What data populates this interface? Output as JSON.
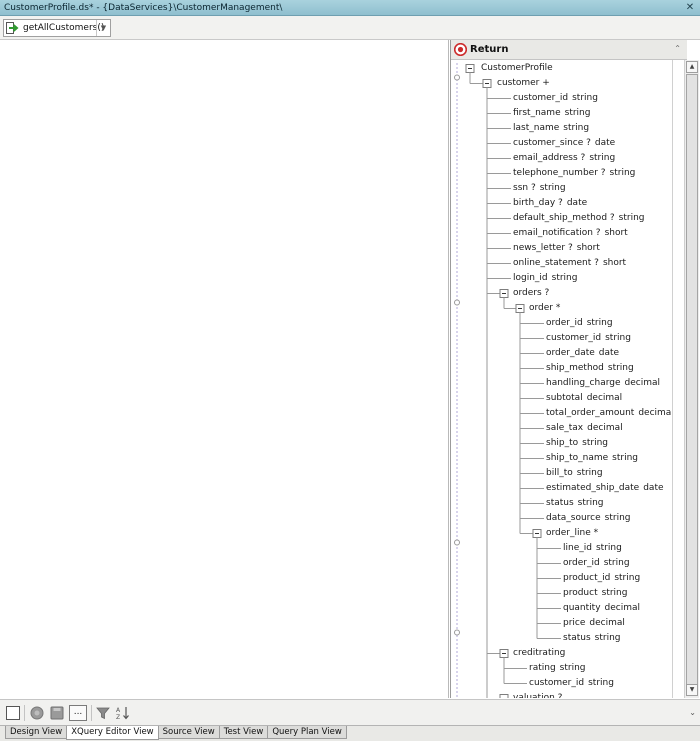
{
  "window": {
    "title": "CustomerProfile.ds* - {DataServices}\\CustomerManagement\\",
    "close_label": "✕"
  },
  "toolbar": {
    "function_label": "getAllCustomers()"
  },
  "return_panel": {
    "title": "Return"
  },
  "tree": [
    {
      "name": "CustomerProfile",
      "type": "",
      "level": 0,
      "toggle": "minus"
    },
    {
      "name": "customer +",
      "type": "",
      "level": 1,
      "toggle": "minus"
    },
    {
      "name": "customer_id",
      "type": "string",
      "level": 2
    },
    {
      "name": "first_name",
      "type": "string",
      "level": 2
    },
    {
      "name": "last_name",
      "type": "string",
      "level": 2
    },
    {
      "name": "customer_since ?",
      "type": "date",
      "level": 2
    },
    {
      "name": "email_address ?",
      "type": "string",
      "level": 2
    },
    {
      "name": "telephone_number ?",
      "type": "string",
      "level": 2
    },
    {
      "name": "ssn ?",
      "type": "string",
      "level": 2
    },
    {
      "name": "birth_day ?",
      "type": "date",
      "level": 2
    },
    {
      "name": "default_ship_method ?",
      "type": "string",
      "level": 2
    },
    {
      "name": "email_notification ?",
      "type": "short",
      "level": 2
    },
    {
      "name": "news_letter ?",
      "type": "short",
      "level": 2
    },
    {
      "name": "online_statement ?",
      "type": "short",
      "level": 2
    },
    {
      "name": "login_id",
      "type": "string",
      "level": 2
    },
    {
      "name": "orders ?",
      "type": "",
      "level": 2,
      "toggle": "minus"
    },
    {
      "name": "order *",
      "type": "",
      "level": 3,
      "toggle": "minus"
    },
    {
      "name": "order_id",
      "type": "string",
      "level": 4
    },
    {
      "name": "customer_id",
      "type": "string",
      "level": 4
    },
    {
      "name": "order_date",
      "type": "date",
      "level": 4
    },
    {
      "name": "ship_method",
      "type": "string",
      "level": 4
    },
    {
      "name": "handling_charge",
      "type": "decimal",
      "level": 4
    },
    {
      "name": "subtotal",
      "type": "decimal",
      "level": 4
    },
    {
      "name": "total_order_amount",
      "type": "decimal",
      "level": 4
    },
    {
      "name": "sale_tax",
      "type": "decimal",
      "level": 4
    },
    {
      "name": "ship_to",
      "type": "string",
      "level": 4
    },
    {
      "name": "ship_to_name",
      "type": "string",
      "level": 4
    },
    {
      "name": "bill_to",
      "type": "string",
      "level": 4
    },
    {
      "name": "estimated_ship_date",
      "type": "date",
      "level": 4
    },
    {
      "name": "status",
      "type": "string",
      "level": 4
    },
    {
      "name": "data_source",
      "type": "string",
      "level": 4
    },
    {
      "name": "order_line *",
      "type": "",
      "level": 4,
      "toggle": "minus"
    },
    {
      "name": "line_id",
      "type": "string",
      "level": 5
    },
    {
      "name": "order_id",
      "type": "string",
      "level": 5
    },
    {
      "name": "product_id",
      "type": "string",
      "level": 5
    },
    {
      "name": "product",
      "type": "string",
      "level": 5
    },
    {
      "name": "quantity",
      "type": "decimal",
      "level": 5
    },
    {
      "name": "price",
      "type": "decimal",
      "level": 5
    },
    {
      "name": "status",
      "type": "string",
      "level": 5
    },
    {
      "name": "creditrating",
      "type": "",
      "level": 2,
      "toggle": "minus"
    },
    {
      "name": "rating",
      "type": "string",
      "level": 3
    },
    {
      "name": "customer_id",
      "type": "string",
      "level": 3
    },
    {
      "name": "valuation ?",
      "type": "",
      "level": 2,
      "toggle": "minus"
    }
  ],
  "bottom_toolbar": {
    "more_label": "..."
  },
  "tabs": [
    {
      "label": "Design View",
      "active": false
    },
    {
      "label": "XQuery Editor View",
      "active": true
    },
    {
      "label": "Source View",
      "active": false
    },
    {
      "label": "Test View",
      "active": false
    },
    {
      "label": "Query Plan View",
      "active": false
    }
  ],
  "colors": {
    "title_bar": "#9ccad8",
    "return_icon": "#cc2b2b",
    "tree_text": "#1b1b1b",
    "function_arrow": "#2f9a2f"
  }
}
